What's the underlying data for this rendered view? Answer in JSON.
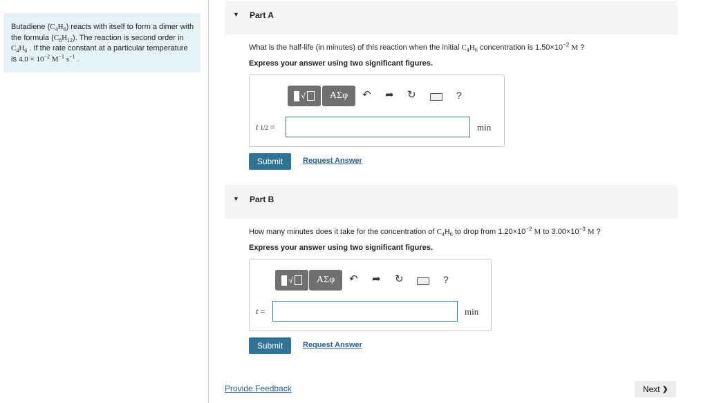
{
  "problem": {
    "text_html": "Butadiene (<span class=\"serif\">C<sub>4</sub>H<sub>6</sub></span>) reacts with itself to form a dimer with the formula (<span class=\"serif\">C<sub>8</sub>H<sub>12</sub></span>). The reaction is second order in <span class=\"serif\">C<sub>4</sub>H<sub>6</sub></span> . If the rate constant at a particular temperature is <span class=\"serif\">4.0 × 10<sup>−2</sup> M<sup>−1</sup> s<sup>−1</sup></span> ."
  },
  "toolbar": {
    "greek": "ΑΣφ",
    "sqrt": "√",
    "undo": "↶",
    "redo": "➦",
    "reset": "↻",
    "help": "?"
  },
  "part_a": {
    "title": "Part A",
    "question_html": "What is the half-life (in minutes) of this reaction when the initial <span class=\"serif\">C<sub>4</sub>H<sub>6</sub></span> concentration is 1.50×10<sup>−2</sup> <span class=\"serif\">M</span> ?",
    "hint": "Express your answer using two significant figures.",
    "var_label": "t",
    "var_sub": "1/2",
    "equals": "=",
    "input_value": "",
    "unit": "min",
    "submit": "Submit",
    "request": "Request Answer"
  },
  "part_b": {
    "title": "Part B",
    "question_html": "How many minutes does it take for the concentration of <span class=\"serif\">C<sub>4</sub>H<sub>6</sub></span> to drop from 1.20×10<sup>−2</sup> <span class=\"serif\">M</span> to 3.00×10<sup>−3</sup> <span class=\"serif\">M</span> ?",
    "hint": "Express your answer using two significant figures.",
    "var_label": "t",
    "equals": "=",
    "input_value": "",
    "unit": "min",
    "submit": "Submit",
    "request": "Request Answer"
  },
  "footer": {
    "feedback": "Provide Feedback",
    "next": "Next",
    "next_chevron": "❯"
  }
}
